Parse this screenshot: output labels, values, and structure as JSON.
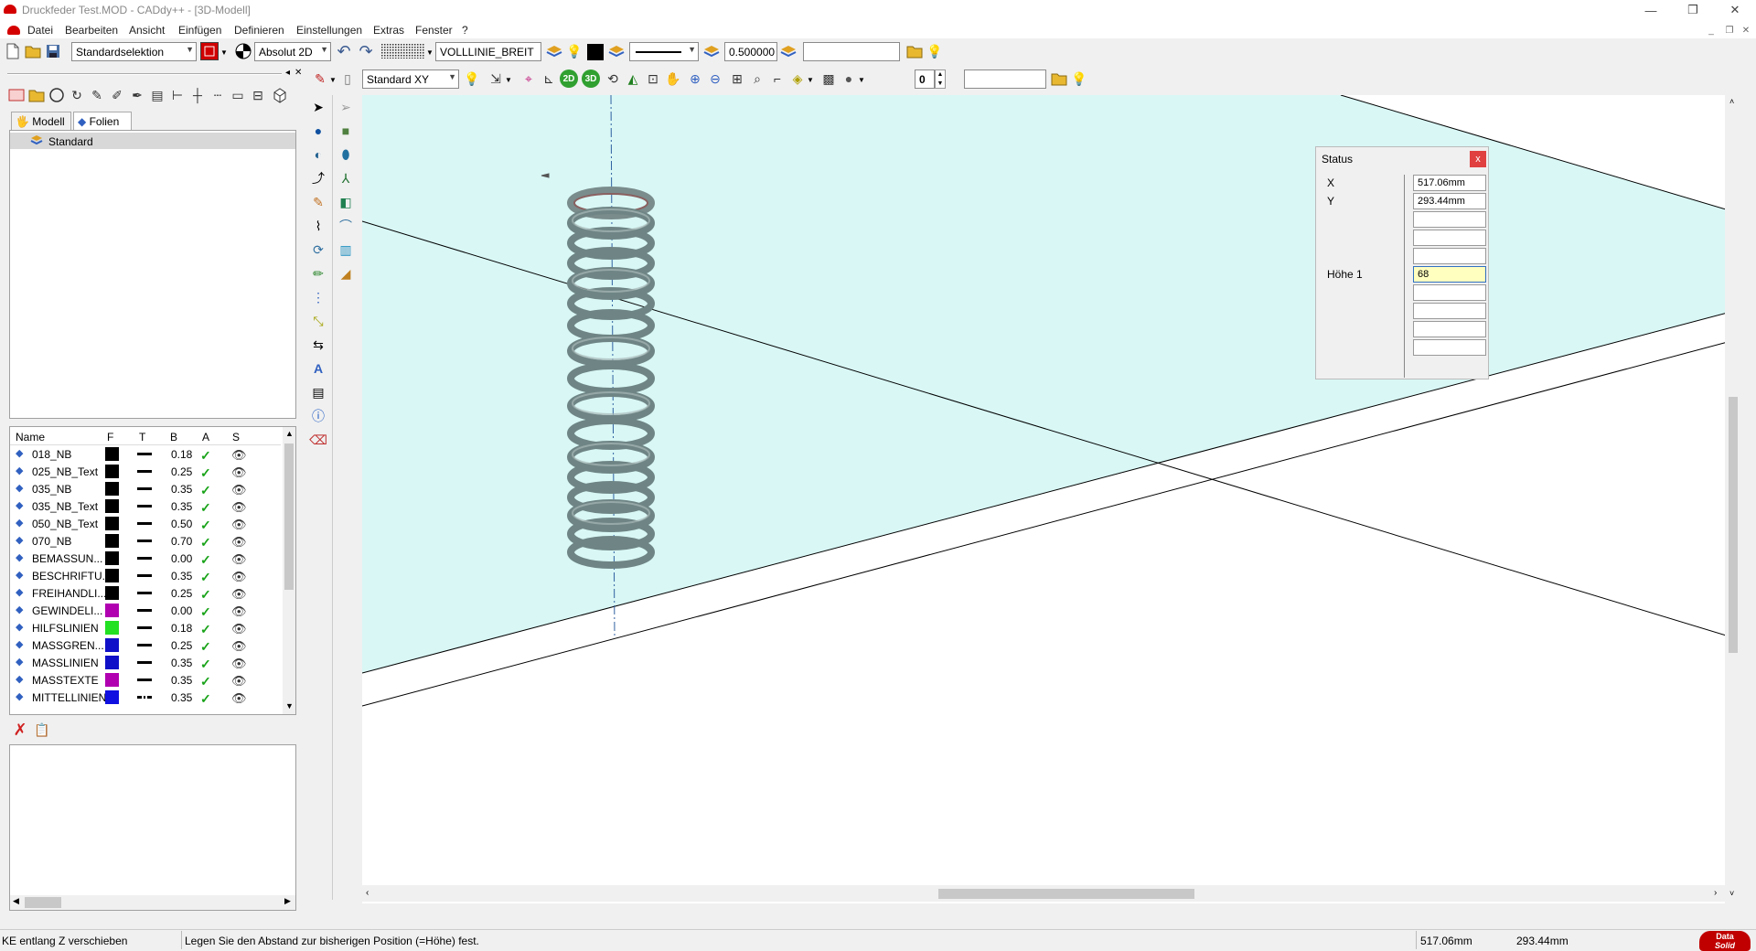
{
  "window": {
    "title": "Druckfeder Test.MOD  -  CADdy++ - [3D-Modell]",
    "minimize_glyph": "—",
    "restore_glyph": "❐",
    "close_glyph": "✕"
  },
  "menu": {
    "items": [
      "Datei",
      "Bearbeiten",
      "Ansicht",
      "Einfügen",
      "Definieren",
      "Einstellungen",
      "Extras",
      "Fenster",
      "?"
    ]
  },
  "toolbar1": {
    "selection_mode": "Standardselektion",
    "coord_mode": "Absolut 2D",
    "line_type": "VOLLLINIE_BREIT",
    "line_width": "0.500000",
    "text_input": ""
  },
  "toolbar2": {
    "view_mode": "Standard XY",
    "btn_2d": "2D",
    "btn_3d": "3D",
    "level_value": "0",
    "search_input": ""
  },
  "panel": {
    "tabs": [
      "Modell",
      "Folien"
    ],
    "active_tab": "Folien",
    "tree_root": "Standard",
    "layer_columns": [
      "Name",
      "F",
      "T",
      "B",
      "A",
      "S"
    ],
    "layers": [
      {
        "name": "018_NB",
        "color": "#000000",
        "width": "0.18",
        "line": "solid"
      },
      {
        "name": "025_NB_Text",
        "color": "#000000",
        "width": "0.25",
        "line": "solid"
      },
      {
        "name": "035_NB",
        "color": "#000000",
        "width": "0.35",
        "line": "solid"
      },
      {
        "name": "035_NB_Text",
        "color": "#000000",
        "width": "0.35",
        "line": "solid"
      },
      {
        "name": "050_NB_Text",
        "color": "#000000",
        "width": "0.50",
        "line": "solid"
      },
      {
        "name": "070_NB",
        "color": "#000000",
        "width": "0.70",
        "line": "solid"
      },
      {
        "name": "BEMASSUN...",
        "color": "#000000",
        "width": "0.00",
        "line": "solid"
      },
      {
        "name": "BESCHRIFTU...",
        "color": "#000000",
        "width": "0.35",
        "line": "solid"
      },
      {
        "name": "FREIHANDLI...",
        "color": "#000000",
        "width": "0.25",
        "line": "solid"
      },
      {
        "name": "GEWINDELI...",
        "color": "#b000b0",
        "width": "0.00",
        "line": "solid"
      },
      {
        "name": "HILFSLINIEN",
        "color": "#22e022",
        "width": "0.18",
        "line": "solid"
      },
      {
        "name": "MASSGREN...",
        "color": "#1010c8",
        "width": "0.25",
        "line": "solid"
      },
      {
        "name": "MASSLINIEN",
        "color": "#1010c8",
        "width": "0.35",
        "line": "solid"
      },
      {
        "name": "MASSTEXTE",
        "color": "#b000b0",
        "width": "0.35",
        "line": "solid"
      },
      {
        "name": "MITTELLINIEN",
        "color": "#1010e0",
        "width": "0.35",
        "line": "dashdot"
      }
    ]
  },
  "status_dialog": {
    "title": "Status",
    "close": "x",
    "x_label": "X",
    "x_value": "517.06mm",
    "y_label": "Y",
    "y_value": "293.44mm",
    "hoehe_label": "Höhe 1",
    "hoehe_value": "68"
  },
  "statusbar": {
    "mode": "KE entlang Z verschieben",
    "prompt": "Legen Sie den Abstand zur bisherigen Position (=Höhe) fest.",
    "x": "517.06mm",
    "y": "293.44mm",
    "logo_line1": "Data",
    "logo_line2": "Solid"
  }
}
